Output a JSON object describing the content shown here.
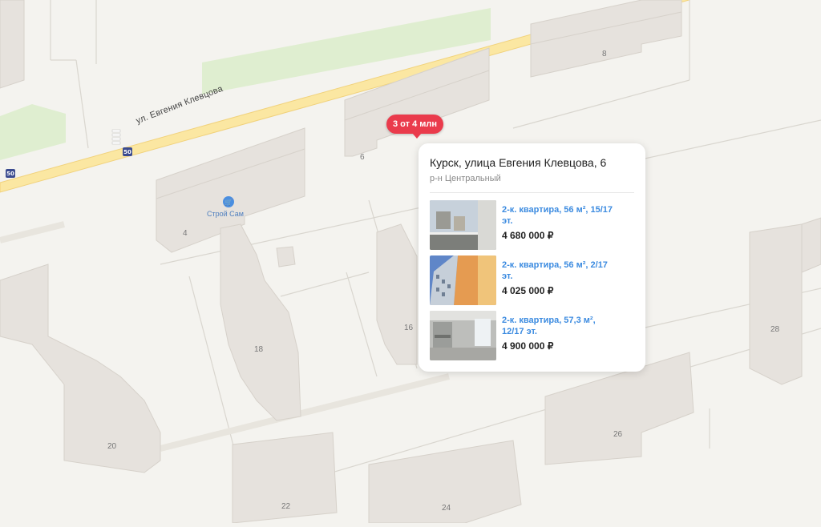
{
  "map": {
    "street_name": "ул. Евгения Клевцова",
    "transit_badge": "50",
    "poi": {
      "name": "Строй Сам",
      "icon": "shopping-basket-icon"
    },
    "building_numbers": [
      "8",
      "6",
      "4",
      "18",
      "16",
      "28",
      "20",
      "26",
      "22",
      "24"
    ]
  },
  "price_pin": {
    "label": "3 от 4 млн",
    "color": "#ea3b4c"
  },
  "popup": {
    "title": "Курск, улица Евгения Клевцова, 6",
    "district": "р-н Центральный",
    "listings": [
      {
        "desc": "2-к. квартира, 56 м², 15/17 эт.",
        "price": "4 680 000 ₽"
      },
      {
        "desc": "2-к. квартира, 56 м², 2/17 эт.",
        "price": "4 025 000 ₽"
      },
      {
        "desc": "2-к. квартира, 57,3 м², 12/17 эт.",
        "price": "4 900 000 ₽"
      }
    ]
  },
  "colors": {
    "link": "#3c8be0",
    "park": "#dfeed0",
    "road": "#fbe7a2",
    "building": "#e6e2dd"
  }
}
